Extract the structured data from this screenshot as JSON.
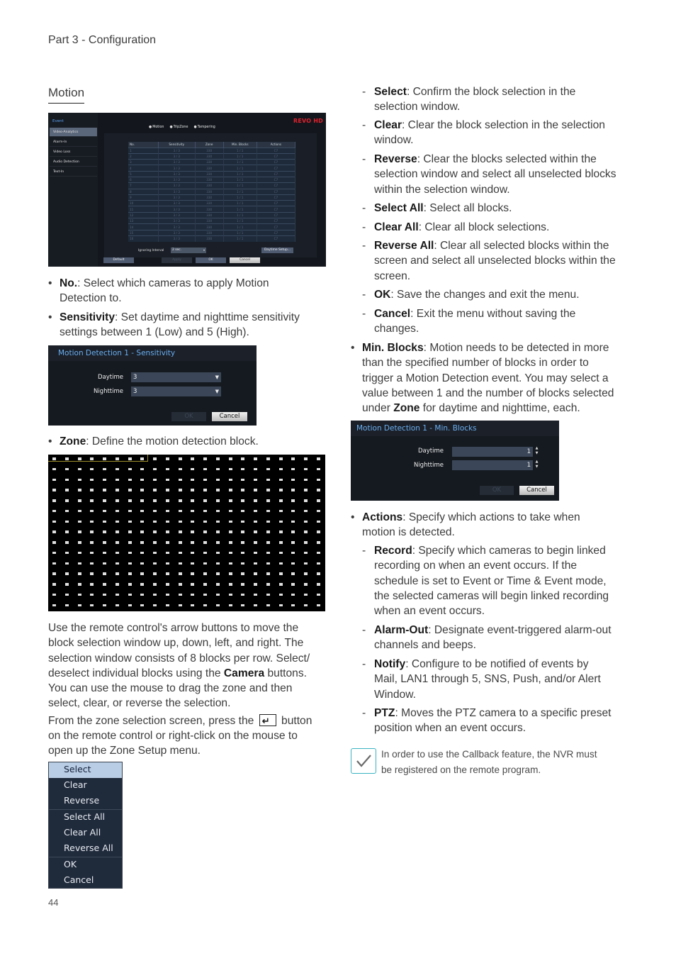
{
  "header": {
    "running_head": "Part 3 - Configuration",
    "page_number": "44"
  },
  "section": {
    "title": "Motion"
  },
  "event_screen": {
    "sidebar_title": "Event",
    "sidebar_items": [
      "Video-Analytics",
      "Alarm-In",
      "Video Loss",
      "Audio Detection",
      "Text-In"
    ],
    "active_item": "Video-Analytics",
    "radio_options": [
      "Motion",
      "TripZone",
      "Tampering"
    ],
    "logo": "REVO HD",
    "table": {
      "headers": [
        "No.",
        "Sensitivity",
        "Zone",
        "Min. Blocks",
        "Actions"
      ],
      "rows": [
        [
          "1",
          "3 / 3",
          "330",
          "1 / 1",
          "C7"
        ],
        [
          "2",
          "3 / 3",
          "330",
          "1 / 1",
          "C7"
        ],
        [
          "3",
          "3 / 3",
          "330",
          "1 / 1",
          "C7"
        ],
        [
          "4",
          "3 / 3",
          "330",
          "1 / 1",
          "C7"
        ],
        [
          "5",
          "3 / 3",
          "330",
          "1 / 1",
          "C7"
        ],
        [
          "6",
          "3 / 3",
          "330",
          "1 / 1",
          "C7"
        ],
        [
          "7",
          "3 / 3",
          "330",
          "1 / 1",
          "C7"
        ],
        [
          "8",
          "3 / 3",
          "330",
          "1 / 1",
          "C7"
        ],
        [
          "9",
          "3 / 3",
          "330",
          "1 / 1",
          "C7"
        ],
        [
          "10",
          "3 / 3",
          "330",
          "1 / 1",
          "C7"
        ],
        [
          "11",
          "3 / 3",
          "330",
          "1 / 1",
          "C7"
        ],
        [
          "12",
          "3 / 3",
          "330",
          "1 / 1",
          "C7"
        ],
        [
          "13",
          "3 / 3",
          "330",
          "1 / 1",
          "C7"
        ],
        [
          "14",
          "3 / 3",
          "330",
          "1 / 1",
          "C7"
        ],
        [
          "15",
          "3 / 3",
          "330",
          "1 / 1",
          "C7"
        ],
        [
          "16",
          "3 / 3",
          "330",
          "1 / 1",
          "C7"
        ]
      ]
    },
    "ignoring_interval_label": "Ignoring Interval",
    "ignoring_interval_value": "2 sec.",
    "daytime_setup_label": "Daytime Setup...",
    "buttons": {
      "default": "Default",
      "apply": "Apply",
      "ok": "OK",
      "cancel": "Cancel"
    }
  },
  "left_text": {
    "no_bold": "No.",
    "no_text": ": Select which cameras to apply Motion",
    "no_text2": "Detection to.",
    "sens_bold": "Sensitivity",
    "sens_text": ": Set daytime and nighttime sensitivity",
    "sens_text2": "settings between 1 (Low) and 5 (High).",
    "zone_bold": "Zone",
    "zone_text": ": Define the motion detection block.",
    "para1": [
      "Use the remote control's arrow buttons to move the",
      "block selection window up, down, left, and right. The",
      "selection window consists of 8 blocks per row. Select/"
    ],
    "para1_l4_pre": "deselect individual blocks using the ",
    "para1_l4_bold": "Camera",
    "para1_l4_post": " buttons.",
    "para1_rest": [
      "You can use the mouse to drag the zone and then",
      "select, clear, or reverse the selection."
    ],
    "para2_l1_pre": "From the zone selection screen, press the",
    "para2_l1_post": "button",
    "para2_rest": [
      "on the remote control or right-click on the mouse to",
      "open up the Zone Setup menu."
    ]
  },
  "sensitivity_dialog": {
    "title": "Motion Detection 1 - Sensitivity",
    "daytime_label": "Daytime",
    "daytime_value": "3",
    "nighttime_label": "Nighttime",
    "nighttime_value": "3",
    "ok": "OK",
    "cancel": "Cancel"
  },
  "zone_grid": {
    "columns": 22,
    "rows": 15,
    "selection_window_blocks": 8
  },
  "zone_menu": {
    "items": [
      "Select",
      "Clear",
      "Reverse",
      "Select All",
      "Clear All",
      "Reverse All",
      "OK",
      "Cancel"
    ],
    "active": "Select"
  },
  "right_text": {
    "dash_items": [
      {
        "bold": "Select",
        "lines": [
          ": Confirm the block selection in the",
          "selection window."
        ]
      },
      {
        "bold": "Clear",
        "lines": [
          ": Clear the block selection in the selection",
          "window."
        ]
      },
      {
        "bold": "Reverse",
        "lines": [
          ": Clear the blocks selected within the",
          "selection window and select all unselected blocks",
          "within the selection window."
        ]
      },
      {
        "bold": "Select All",
        "lines": [
          ": Select all blocks."
        ]
      },
      {
        "bold": "Clear All",
        "lines": [
          ": Clear all block selections."
        ]
      },
      {
        "bold": "Reverse All",
        "lines": [
          ": Clear all selected blocks within the",
          "screen and select all unselected blocks within the",
          "screen."
        ]
      },
      {
        "bold": "OK",
        "lines": [
          ": Save the changes and exit the menu."
        ]
      },
      {
        "bold": "Cancel",
        "lines": [
          ": Exit the menu without saving the",
          "changes."
        ]
      }
    ],
    "minblocks_bold": "Min. Blocks",
    "minblocks_lines": [
      ": Motion needs to be detected in more",
      "than the specified number of blocks in order to",
      "trigger a Motion Detection event. You may select a",
      "value between 1 and the number of blocks selected"
    ],
    "minblocks_last_pre": "under ",
    "minblocks_last_bold": "Zone",
    "minblocks_last_post": " for daytime and nighttime, each.",
    "actions_bold": "Actions",
    "actions_lines": [
      ": Specify which actions to take when",
      "motion is detected."
    ],
    "action_items": [
      {
        "bold": "Record",
        "lines": [
          ": Specify which cameras to begin linked",
          "recording on when an event occurs. If the",
          "schedule is set to Event or Time & Event mode,",
          "the selected cameras will begin linked recording",
          "when an event occurs."
        ]
      },
      {
        "bold": "Alarm-Out",
        "lines": [
          ": Designate event-triggered alarm-out",
          "channels and beeps."
        ]
      },
      {
        "bold": "Notify",
        "lines": [
          ": Configure to be notified of events by",
          "Mail, LAN1 through 5, SNS, Push, and/or Alert",
          "Window."
        ]
      },
      {
        "bold": "PTZ",
        "lines": [
          ": Moves the PTZ camera to a specific preset",
          "position when an event occurs."
        ]
      }
    ],
    "note_lines": [
      "In order to use the Callback feature, the NVR must",
      "be registered on the remote program."
    ]
  },
  "minblocks_dialog": {
    "title": "Motion Detection 1 - Min. Blocks",
    "daytime_label": "Daytime",
    "daytime_value": "1",
    "nighttime_label": "Nighttime",
    "nighttime_value": "1",
    "ok": "OK",
    "cancel": "Cancel"
  }
}
